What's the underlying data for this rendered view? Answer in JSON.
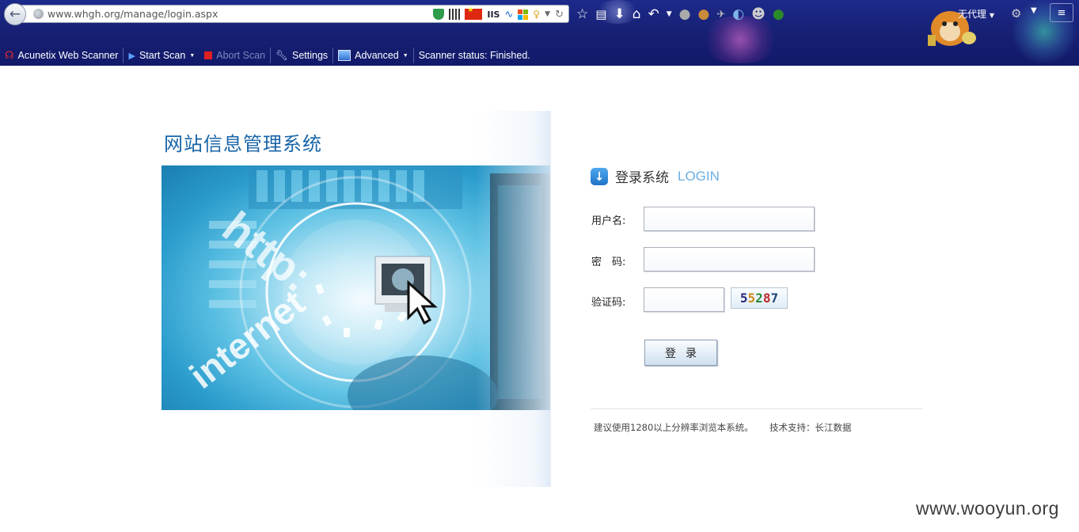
{
  "browser": {
    "url": "www.whgh.org/manage/login.aspx",
    "iis_label": "IIS",
    "proxy_label": "无代理",
    "toolbar_icons": [
      "star-icon",
      "reader-icon",
      "download-icon",
      "home-icon",
      "undo-icon",
      "dropdown-icon",
      "extension-icon",
      "cookie-icon",
      "addon-icon",
      "globe-switch-icon",
      "skull-icon"
    ]
  },
  "scanner_bar": {
    "product": "Acunetix Web Scanner",
    "start_scan": "Start Scan",
    "abort_scan": "Abort Scan",
    "settings": "Settings",
    "advanced": "Advanced",
    "status": "Scanner status: Finished."
  },
  "page": {
    "title": "网站信息管理系统",
    "login_title": "登录系统",
    "login_en": "LOGIN",
    "username_label": "用户名:",
    "password_label": "密　码:",
    "captcha_label": "验证码:",
    "captcha_digits": [
      {
        "char": "5",
        "color": "#2a2a7a"
      },
      {
        "char": "5",
        "color": "#d18a1a"
      },
      {
        "char": "2",
        "color": "#2a8a3a"
      },
      {
        "char": "8",
        "color": "#c02828"
      },
      {
        "char": "7",
        "color": "#22447a"
      }
    ],
    "submit_label": "登录",
    "footer_left": "建议使用1280以上分辨率浏览本系统。",
    "footer_right": "技术支持：长江数据"
  },
  "banner_text": {
    "http": "http:",
    "internet": "internet"
  },
  "watermark": "www.wooyun.org",
  "colors": {
    "chrome_bg": "#161f72",
    "title_blue": "#1865a8",
    "login_en": "#6aaee0"
  }
}
